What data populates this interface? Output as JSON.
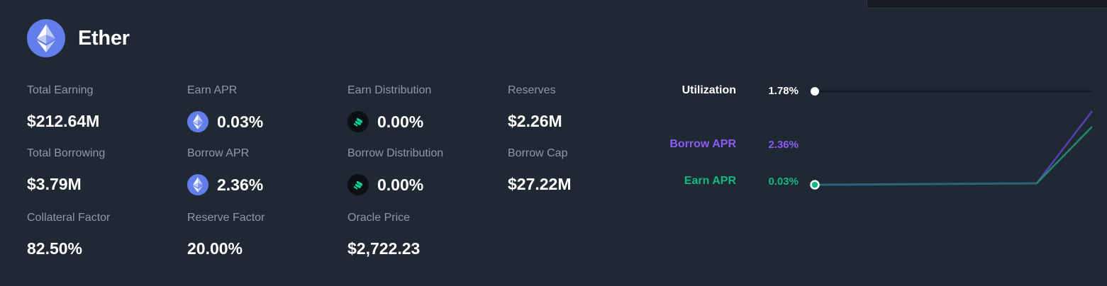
{
  "asset": {
    "name": "Ether",
    "icon": "ethereum-icon",
    "brand_color": "#627eea"
  },
  "stats": {
    "total_earning": {
      "label": "Total Earning",
      "value": "$212.64M"
    },
    "total_borrowing": {
      "label": "Total Borrowing",
      "value": "$3.79M"
    },
    "collateral_factor": {
      "label": "Collateral Factor",
      "value": "82.50%"
    },
    "earn_apr": {
      "label": "Earn APR",
      "value": "0.03%",
      "icon": "ethereum-icon"
    },
    "borrow_apr": {
      "label": "Borrow APR",
      "value": "2.36%",
      "icon": "ethereum-icon"
    },
    "reserve_factor": {
      "label": "Reserve Factor",
      "value": "20.00%"
    },
    "earn_distribution": {
      "label": "Earn Distribution",
      "value": "0.00%",
      "icon": "compound-icon"
    },
    "borrow_distribution": {
      "label": "Borrow Distribution",
      "value": "0.00%",
      "icon": "compound-icon"
    },
    "oracle_price": {
      "label": "Oracle Price",
      "value": "$2,722.23"
    },
    "reserves": {
      "label": "Reserves",
      "value": "$2.26M"
    },
    "borrow_cap": {
      "label": "Borrow Cap",
      "value": "$27.22M"
    }
  },
  "utilization_chart": {
    "utilization": {
      "label": "Utilization",
      "value": "1.78%",
      "fraction": 0.0178
    },
    "borrow_apr": {
      "label": "Borrow APR",
      "value": "2.36%",
      "color": "#8b5cf6"
    },
    "earn_apr": {
      "label": "Earn APR",
      "value": "0.03%",
      "color": "#10b981"
    },
    "kink_fraction": 0.8
  },
  "colors": {
    "background": "#1f2833",
    "label": "#8e9aa8",
    "compound_green": "#00d395"
  }
}
